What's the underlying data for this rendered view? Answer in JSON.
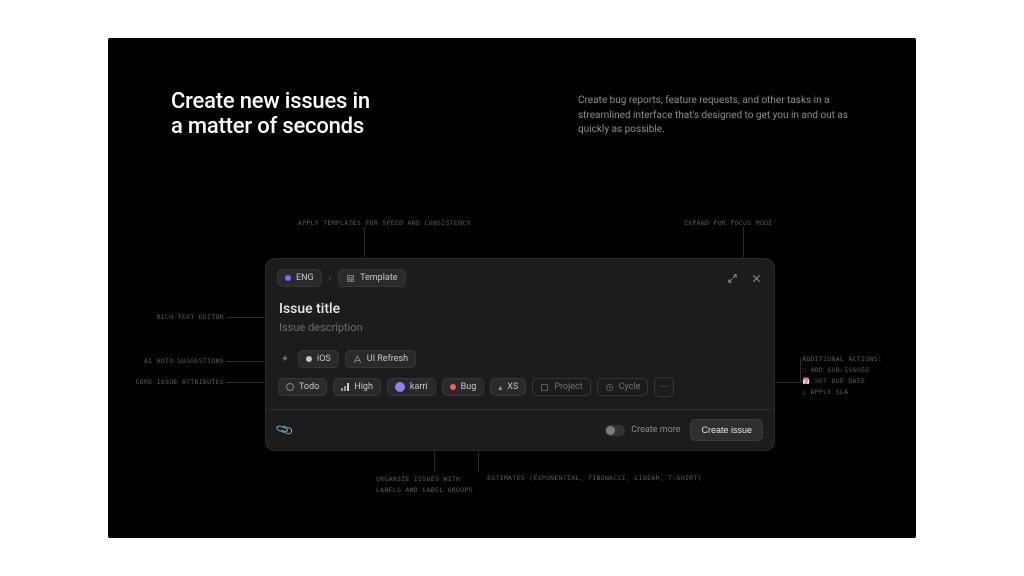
{
  "hero": {
    "headline_l1": "Create new issues in",
    "headline_l2": "a matter of seconds",
    "subhead": "Create bug reports, feature requests, and other tasks in a streamlined interface that's designed to get you in and out as quickly as possible."
  },
  "annotations": {
    "templates": "Apply templates for speed and consistency",
    "expand": "Expand for focus mode",
    "rich_text": "Rich text editor",
    "ai": "AI auto-suggestions",
    "core": "Core issue attributes",
    "additional_title": "Additional actions:",
    "additional_items": [
      "Add sub-issues",
      "Set due date",
      "Apply SLA"
    ],
    "labels_l1": "Organize issues with",
    "labels_l2": "labels and label groups",
    "estimates": "Estimates (exponential, Fibonacci, linear, T-shirt)"
  },
  "modal": {
    "team": "ENG",
    "template": "Template",
    "title": "Issue title",
    "description": "Issue description",
    "suggestions": [
      {
        "name": "iOS",
        "color": "#c3c3c7"
      },
      {
        "name": "UI Refresh",
        "color": "#7d7dff"
      }
    ],
    "attributes": {
      "status": "Todo",
      "priority": "High",
      "assignee": "karri",
      "label": {
        "name": "Bug",
        "color": "#ff5c5c"
      },
      "estimate": "XS",
      "project_placeholder": "Project",
      "cycle_placeholder": "Cycle"
    },
    "create_more": "Create more",
    "submit": "Create issue"
  }
}
